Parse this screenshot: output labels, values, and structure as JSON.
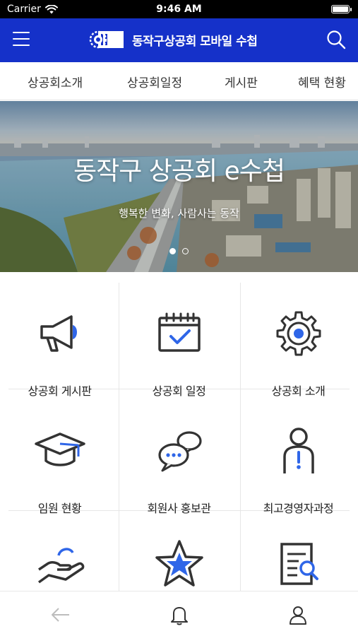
{
  "status_bar": {
    "carrier": "Carrier",
    "time": "9:46 AM",
    "battery_level": 1.0,
    "icons": [
      "wifi-icon",
      "battery-icon"
    ]
  },
  "header": {
    "title": "동작구상공회 모바일 수첩",
    "background_color": "#1531c9",
    "icons": [
      "hamburger-menu-icon",
      "logo-gear-icon",
      "search-icon"
    ]
  },
  "tabs": [
    {
      "label": "상공회소개"
    },
    {
      "label": "상공회일정"
    },
    {
      "label": "게시판"
    },
    {
      "label": "혜택 현황"
    }
  ],
  "banner": {
    "headline": "동작구 상공회 e수첩",
    "subline": "행복한 변화, 사람사는 동작",
    "slide_count": 2,
    "active_slide": 1
  },
  "menu": [
    {
      "label": "상공회 게시판",
      "icon": "megaphone-icon"
    },
    {
      "label": "상공회 일정",
      "icon": "calendar-check-icon"
    },
    {
      "label": "상공회 소개",
      "icon": "gear-icon"
    },
    {
      "label": "임원 현황",
      "icon": "graduation-cap-icon"
    },
    {
      "label": "회원사 홍보관",
      "icon": "chat-bubbles-icon"
    },
    {
      "label": "최고경영자과정",
      "icon": "person-info-icon"
    },
    {
      "label": "",
      "icon": "hand-giving-icon"
    },
    {
      "label": "",
      "icon": "star-icon"
    },
    {
      "label": "",
      "icon": "document-search-icon"
    }
  ],
  "accent_color": "#2f66e8",
  "bottom_bar": {
    "icons": [
      "back-arrow-icon",
      "bell-icon",
      "user-icon"
    ]
  }
}
